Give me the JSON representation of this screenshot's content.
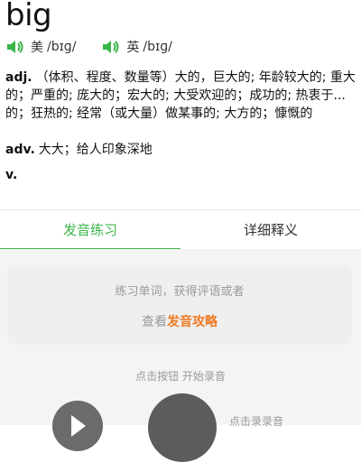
{
  "entry": {
    "word": "big",
    "pronunciations": [
      {
        "region": "美",
        "ipa": "/bɪɡ/"
      },
      {
        "region": "英",
        "ipa": "/bɪɡ/"
      }
    ],
    "definitions": [
      {
        "pos": "adj.",
        "text": "（体积、程度、数量等）大的，巨大的; 年龄较大的; 重大的；严重的; 庞大的；宏大的; 大受欢迎的；成功的; 热衷于...的；狂热的; 经常（或大量）做某事的; 大方的；慷慨的"
      },
      {
        "pos": "adv.",
        "text": "大大；给人印象深地"
      },
      {
        "pos": "v.",
        "text": ""
      }
    ]
  },
  "tabs": [
    {
      "label": "发音练习",
      "active": true
    },
    {
      "label": "详细释义",
      "active": false
    }
  ],
  "practice": {
    "line1": "练习单词，获得评语或者",
    "line2_prefix": "查看",
    "line2_link": "发音攻略",
    "hint": "点击按钮 开始录音",
    "record_label": "点击录录音"
  },
  "colors": {
    "accent_green": "#3bb54a",
    "link_orange": "#f07a22"
  },
  "icons": [
    "speaker-icon",
    "play-icon",
    "record-icon"
  ]
}
